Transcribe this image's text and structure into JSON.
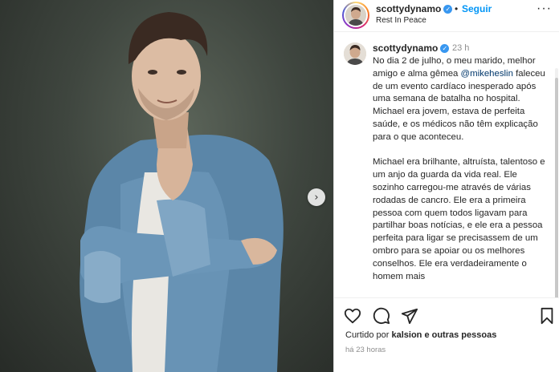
{
  "header": {
    "username": "scottydynamo",
    "separator": "•",
    "follow_label": "Seguir",
    "subtitle": "Rest In Peace",
    "more_label": "···"
  },
  "caption": {
    "username": "scottydynamo",
    "time": "23 h",
    "paragraph1_before": "No dia 2 de julho, o meu marido, melhor amigo e alma gêmea ",
    "mention": "@mikeheslin",
    "paragraph1_after": " faleceu de um evento cardíaco inesperado após uma semana de batalha no hospital. Michael era jovem, estava de perfeita saúde, e os médicos não têm explicação para o que aconteceu.",
    "paragraph2": "Michael era brilhante, altruísta, talentoso e um anjo da guarda da vida real. Ele sozinho carregou-me através de várias rodadas de cancro. Ele era a primeira pessoa com quem todos ligavam para partilhar boas notícias, e ele era a pessoa perfeita para ligar se precisassem de um ombro para se apoiar ou os melhores conselhos. Ele era verdadeiramente o homem mais"
  },
  "likes": {
    "prefix": "Curtido por ",
    "user": "kalsion",
    "suffix": " e outras pessoas"
  },
  "posted": "há 23 horas",
  "icons": {
    "like": "heart-icon",
    "comment": "comment-icon",
    "share": "share-icon",
    "save": "bookmark-icon",
    "next": "chevron-right-icon",
    "verified": "verified-badge-icon"
  },
  "colors": {
    "follow": "#0095f6",
    "mention": "#00376b",
    "verified": "#3897f0",
    "muted": "#8e8e8e"
  }
}
